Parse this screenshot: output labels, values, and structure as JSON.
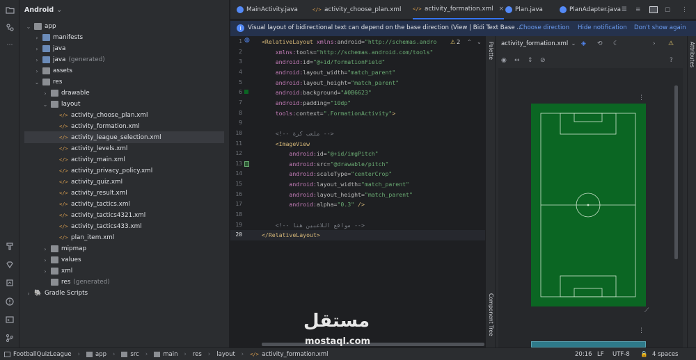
{
  "project_panel": {
    "title": "Android",
    "tree": [
      {
        "label": "app",
        "suffix": ""
      },
      {
        "label": "manifests",
        "suffix": ""
      },
      {
        "label": "java",
        "suffix": ""
      },
      {
        "label": "java",
        "suffix": "(generated)"
      },
      {
        "label": "assets",
        "suffix": ""
      },
      {
        "label": "res",
        "suffix": ""
      },
      {
        "label": "drawable",
        "suffix": ""
      },
      {
        "label": "layout",
        "suffix": ""
      },
      {
        "label": "activity_choose_plan.xml",
        "suffix": ""
      },
      {
        "label": "activity_formation.xml",
        "suffix": ""
      },
      {
        "label": "activity_league_selection.xml",
        "suffix": ""
      },
      {
        "label": "activity_levels.xml",
        "suffix": ""
      },
      {
        "label": "activity_main.xml",
        "suffix": ""
      },
      {
        "label": "activity_privacy_policy.xml",
        "suffix": ""
      },
      {
        "label": "activity_quiz.xml",
        "suffix": ""
      },
      {
        "label": "activity_result.xml",
        "suffix": ""
      },
      {
        "label": "activity_tactics.xml",
        "suffix": ""
      },
      {
        "label": "activity_tactics4321.xml",
        "suffix": ""
      },
      {
        "label": "activity_tactics433.xml",
        "suffix": ""
      },
      {
        "label": "plan_item.xml",
        "suffix": ""
      },
      {
        "label": "mipmap",
        "suffix": ""
      },
      {
        "label": "values",
        "suffix": ""
      },
      {
        "label": "xml",
        "suffix": ""
      },
      {
        "label": "res",
        "suffix": "(generated)"
      },
      {
        "label": "Gradle Scripts",
        "suffix": ""
      }
    ]
  },
  "tabs": [
    {
      "label": "MainActivity.java"
    },
    {
      "label": "activity_choose_plan.xml"
    },
    {
      "label": "activity_formation.xml"
    },
    {
      "label": "Plan.java"
    },
    {
      "label": "PlanAdapter.java"
    }
  ],
  "notification": {
    "text": "Visual layout of bidirectional text can depend on the base direction (View | Bidi Text Base ...",
    "choose_direction": "Choose direction",
    "hide_notification": "Hide notification",
    "dont_show_again": "Don't show again"
  },
  "editor": {
    "warning_count": "2",
    "line_numbers": [
      "1",
      "2",
      "3",
      "4",
      "5",
      "6",
      "7",
      "8",
      "9",
      "10",
      "11",
      "12",
      "13",
      "14",
      "15",
      "16",
      "17",
      "18",
      "19",
      "20"
    ],
    "lines": [
      [
        {
          "c": "tg",
          "t": "<RelativeLayout "
        },
        {
          "c": "ns",
          "t": "xmlns:"
        },
        {
          "c": "at",
          "t": "android="
        },
        {
          "c": "vl",
          "t": "\"http://schemas.andro"
        }
      ],
      [
        {
          "c": "ns",
          "t": "    xmlns:"
        },
        {
          "c": "at",
          "t": "tools="
        },
        {
          "c": "vl",
          "t": "\"http://schemas.android.com/tools\""
        }
      ],
      [
        {
          "c": "ns",
          "t": "    android:"
        },
        {
          "c": "at",
          "t": "id="
        },
        {
          "c": "vl",
          "t": "\"@+id/formationField\""
        }
      ],
      [
        {
          "c": "ns",
          "t": "    android:"
        },
        {
          "c": "at",
          "t": "layout_width="
        },
        {
          "c": "vl",
          "t": "\"match_parent\""
        }
      ],
      [
        {
          "c": "ns",
          "t": "    android:"
        },
        {
          "c": "at",
          "t": "layout_height="
        },
        {
          "c": "vl",
          "t": "\"match_parent\""
        }
      ],
      [
        {
          "c": "ns",
          "t": "    android:"
        },
        {
          "c": "at",
          "t": "background="
        },
        {
          "c": "vl",
          "t": "\"#0B6623\""
        }
      ],
      [
        {
          "c": "ns",
          "t": "    android:"
        },
        {
          "c": "at",
          "t": "padding="
        },
        {
          "c": "vl",
          "t": "\"10dp\""
        }
      ],
      [
        {
          "c": "ns",
          "t": "    tools:"
        },
        {
          "c": "at",
          "t": "context="
        },
        {
          "c": "vl",
          "t": "\".FormationActivity\""
        },
        {
          "c": "tg",
          "t": ">"
        }
      ],
      [],
      [
        {
          "c": "cm",
          "t": "    <!-- ملعب كرة -->"
        }
      ],
      [
        {
          "c": "tg",
          "t": "    <ImageView"
        }
      ],
      [
        {
          "c": "ns",
          "t": "        android:"
        },
        {
          "c": "at",
          "t": "id="
        },
        {
          "c": "vl",
          "t": "\"@+id/imgPitch\""
        }
      ],
      [
        {
          "c": "ns",
          "t": "        android:"
        },
        {
          "c": "at",
          "t": "src="
        },
        {
          "c": "vl",
          "t": "\"@drawable/pitch\""
        }
      ],
      [
        {
          "c": "ns",
          "t": "        android:"
        },
        {
          "c": "at",
          "t": "scaleType="
        },
        {
          "c": "vl",
          "t": "\"centerCrop\""
        }
      ],
      [
        {
          "c": "ns",
          "t": "        android:"
        },
        {
          "c": "at",
          "t": "layout_width="
        },
        {
          "c": "vl",
          "t": "\"match_parent\""
        }
      ],
      [
        {
          "c": "ns",
          "t": "        android:"
        },
        {
          "c": "at",
          "t": "layout_height="
        },
        {
          "c": "vl",
          "t": "\"match_parent\""
        }
      ],
      [
        {
          "c": "ns",
          "t": "        android:"
        },
        {
          "c": "at",
          "t": "alpha="
        },
        {
          "c": "vl",
          "t": "\"0.3\""
        },
        {
          "c": "tg",
          "t": " />"
        }
      ],
      [],
      [
        {
          "c": "cm",
          "t": "    <!-- مواقع اللاعبين هنا -->"
        }
      ],
      [
        {
          "c": "tg",
          "t": "</RelativeLayout>"
        }
      ]
    ]
  },
  "design": {
    "file_select": "activity_formation.xml",
    "palette_label": "Palette",
    "component_tree_label": "Component Tree",
    "attributes_label": "Attributes",
    "pitch_color": "#0B6623"
  },
  "status": {
    "crumbs": [
      "FootballQuizLeague",
      "app",
      "src",
      "main",
      "res",
      "layout",
      "activity_formation.xml"
    ],
    "position": "20:16",
    "line_sep": "LF",
    "encoding": "UTF-8",
    "indent": "4 spaces"
  },
  "watermark": {
    "arabic": "مستقل",
    "latin": "mostaql.com"
  }
}
